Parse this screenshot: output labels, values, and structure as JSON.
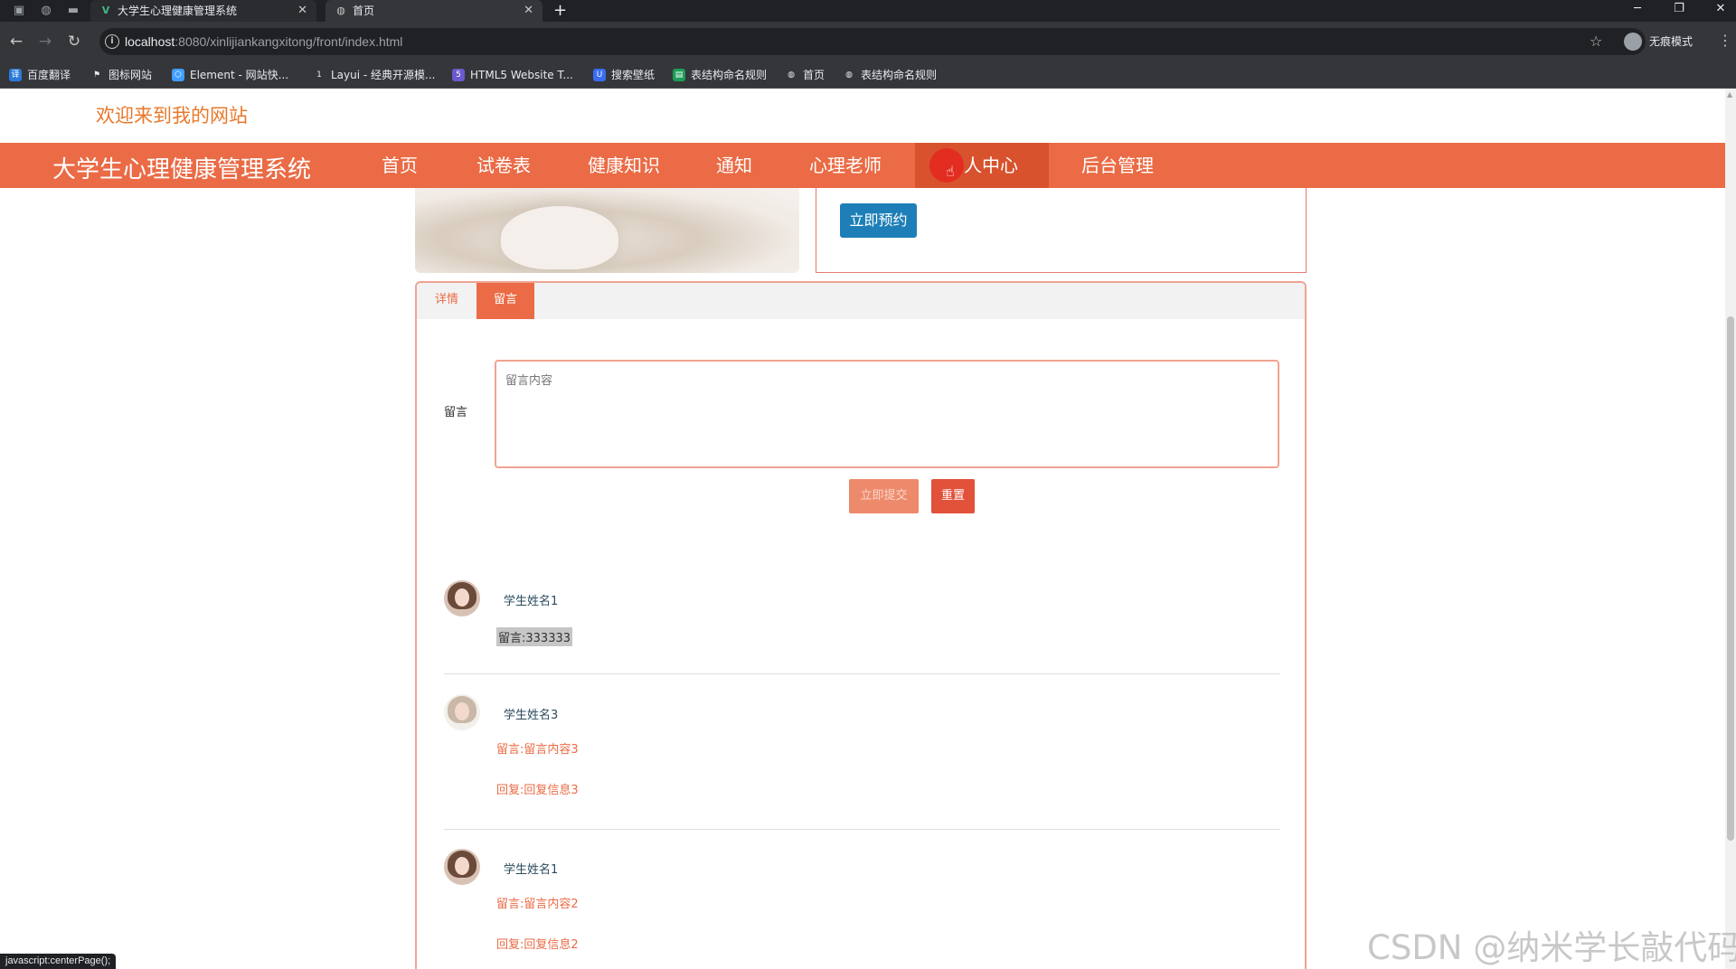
{
  "browser": {
    "tabs": [
      {
        "title": "大学生心理健康管理系统",
        "icon": "v-logo-icon",
        "active": false
      },
      {
        "title": "首页",
        "icon": "globe-icon",
        "active": true
      }
    ],
    "new_tab": "+",
    "url_host": "localhost",
    "url_rest": ":8080/xinlijiankangxitong/front/index.html",
    "profile_label": "无痕模式",
    "bookmarks": [
      {
        "label": "百度翻译",
        "icon": "translate-icon",
        "color": "#2b7bdb"
      },
      {
        "label": "图标网站",
        "icon": "flag-icon",
        "color": "#555555"
      },
      {
        "label": "Element - 网站快...",
        "icon": "element-icon",
        "color": "#409eff"
      },
      {
        "label": "Layui - 经典开源模...",
        "icon": "layui-icon",
        "color": "#666666"
      },
      {
        "label": "HTML5 Website T...",
        "icon": "html5-icon",
        "color": "#6a5acd"
      },
      {
        "label": "搜索壁纸",
        "icon": "wallpaper-icon",
        "color": "#3a6cf4"
      },
      {
        "label": "表结构命名规则",
        "icon": "sheet-icon",
        "color": "#1e9d58"
      },
      {
        "label": "首页",
        "icon": "globe-icon",
        "color": "#555555"
      },
      {
        "label": "表结构命名规则",
        "icon": "globe-icon",
        "color": "#555555"
      }
    ],
    "status_text": "javascript:centerPage();"
  },
  "site": {
    "welcome": "欢迎来到我的网站",
    "brand": "大学生心理健康管理系统",
    "nav": [
      "首页",
      "试卷表",
      "健康知识",
      "通知",
      "心理老师",
      "个人中心",
      "后台管理"
    ],
    "active_nav": "个人中心",
    "nav_color": "#ea6b45"
  },
  "detail": {
    "reserve_button": "立即预约"
  },
  "panel": {
    "tabs": [
      "详情",
      "留言"
    ],
    "active_tab": "留言",
    "comment_label": "留言",
    "textarea_placeholder": "留言内容",
    "submit_button": "立即提交",
    "reset_button": "重置"
  },
  "comments": [
    {
      "name": "学生姓名1",
      "message": "留言:333333",
      "reply": ""
    },
    {
      "name": "学生姓名3",
      "message": "留言:留言内容3",
      "reply": "回复:回复信息3"
    },
    {
      "name": "学生姓名1",
      "message": "留言:留言内容2",
      "reply": "回复:回复信息2"
    }
  ],
  "watermark": "CSDN @纳米学长敲代码"
}
